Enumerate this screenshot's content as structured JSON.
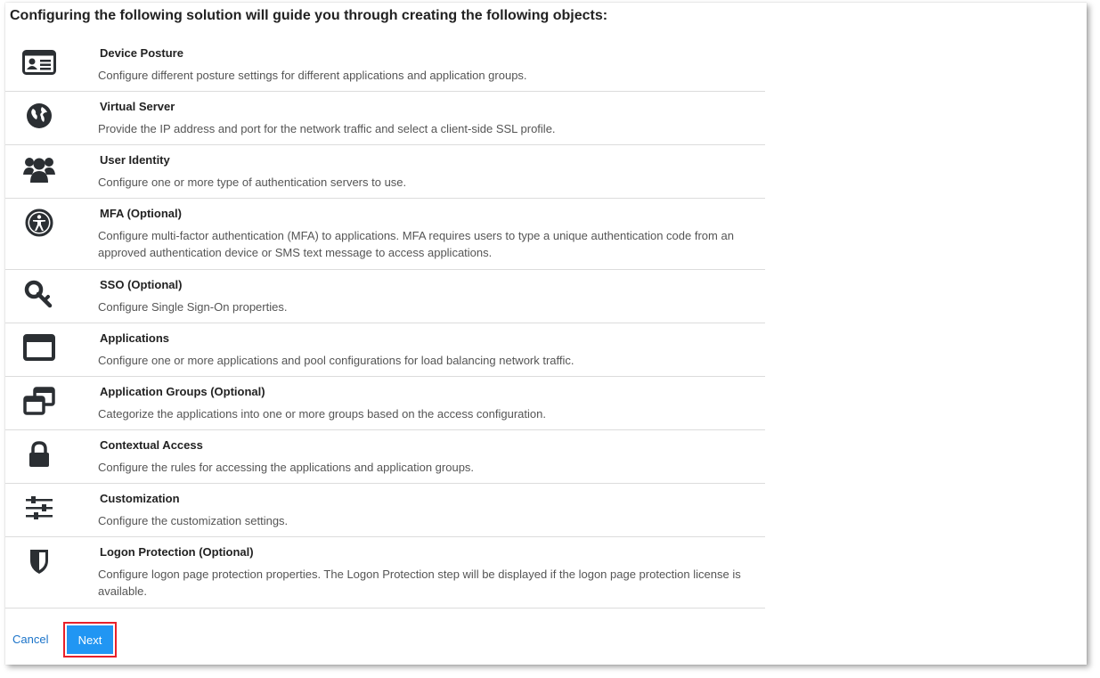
{
  "heading": "Configuring the following solution will guide you through creating the following objects:",
  "items": [
    {
      "icon": "id-card-icon",
      "title": "Device Posture",
      "desc": "Configure different posture settings for different applications and application groups."
    },
    {
      "icon": "globe-icon",
      "title": "Virtual Server",
      "desc": "Provide the IP address and port for the network traffic and select a client-side SSL profile."
    },
    {
      "icon": "users-icon",
      "title": "User Identity",
      "desc": "Configure one or more type of authentication servers to use."
    },
    {
      "icon": "accessibility-icon",
      "title": "MFA (Optional)",
      "desc": "Configure multi-factor authentication (MFA) to applications. MFA requires users to type a unique authentication code from an approved authentication device or SMS text message to access applications."
    },
    {
      "icon": "key-icon",
      "title": "SSO (Optional)",
      "desc": "Configure Single Sign-On properties."
    },
    {
      "icon": "window-icon",
      "title": "Applications",
      "desc": "Configure one or more applications and pool configurations for load balancing network traffic."
    },
    {
      "icon": "clone-icon",
      "title": "Application Groups (Optional)",
      "desc": "Categorize the applications into one or more groups based on the access configuration."
    },
    {
      "icon": "lock-icon",
      "title": "Contextual Access",
      "desc": "Configure the rules for accessing the applications and application groups."
    },
    {
      "icon": "sliders-icon",
      "title": "Customization",
      "desc": "Configure the customization settings."
    },
    {
      "icon": "shield-icon",
      "title": "Logon Protection (Optional)",
      "desc": "Configure logon page protection properties. The Logon Protection step will be displayed if the logon page protection license is available."
    }
  ],
  "footer": {
    "cancel_label": "Cancel",
    "next_label": "Next"
  },
  "colors": {
    "accent": "#2196f3",
    "link": "#1a73c9",
    "highlight": "#e8202a",
    "icon": "#2b2f33"
  }
}
